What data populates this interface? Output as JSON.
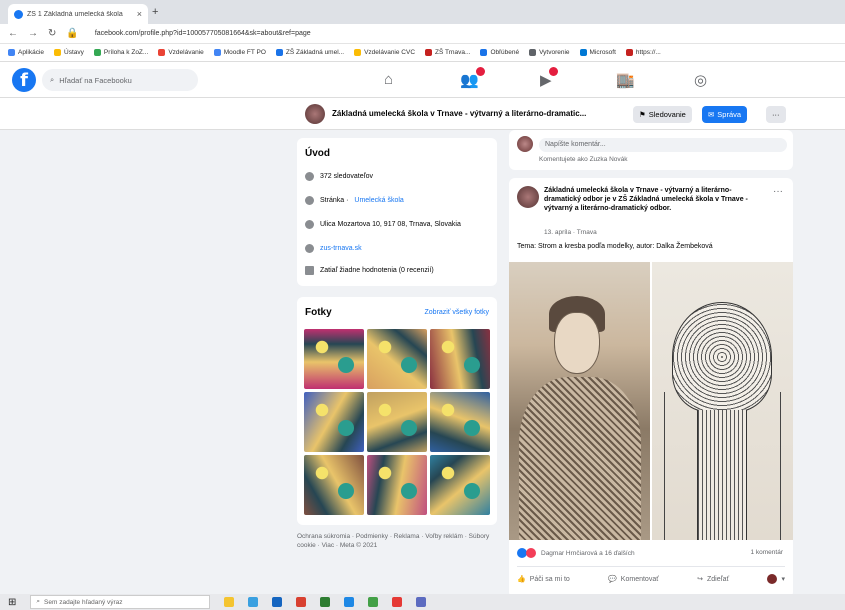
{
  "browser": {
    "tab_title": "ZŠ 1 Základná umelecká škola",
    "tab_close": "×",
    "new_tab": "+",
    "url": "facebook.com/profile.php?id=100057705081664&sk=about&ref=page",
    "bookmarks": [
      "Aplikácie",
      "Ústavy",
      "Príloha k ZoZ...",
      "Vzdelávanie",
      "Moodle FT PO",
      "ZŠ Základná umel...",
      "Vzdelávanie CVC",
      "ZŠ Trnava...",
      "Obľúbené",
      "Vytvorenie",
      "Microsoft",
      "https://..."
    ]
  },
  "fb": {
    "search_placeholder": "Hľadať na Facebooku"
  },
  "page": {
    "name": "Základná umelecká škola v Trnave - výtvarný a literárno-dramatic...",
    "btn_follow": "Sledovanie",
    "btn_message": "Správa",
    "btn_more": "···"
  },
  "intro": {
    "title": "Úvod",
    "rows": [
      {
        "text": "372 sledovateľov",
        "link": ""
      },
      {
        "text": "Stránka · ",
        "link": "Umelecká škola"
      },
      {
        "text": "Ulica Mozartova 10, 917 08, Trnava, Slovakia",
        "link": ""
      },
      {
        "text": "",
        "link": "zus-trnava.sk"
      },
      {
        "text": "Zatiaľ žiadne hodnotenia (0 recenzií)",
        "link": ""
      }
    ]
  },
  "photos": {
    "title": "Fotky",
    "see_all": "Zobraziť všetky fotky",
    "colors": [
      "#c03070",
      "#d8a060",
      "#8a3040",
      "#4060c0",
      "#c0a060",
      "#3060a0",
      "#805040",
      "#c05080",
      "#3080a0"
    ]
  },
  "footer": {
    "text": "Ochrana súkromia · Podmienky · Reklama · Voľby reklám · Súbory cookie · Viac · Meta © 2021"
  },
  "composer": {
    "placeholder": "Napíšte komentár...",
    "note": "Komentujete ako Zuzka Novák"
  },
  "post": {
    "title": "Základná umelecká škola v Trnave - výtvarný a literárno-dramatický odbor je v ZŠ Základná umelecká škola v Trnave - výtvarný a literárno-dramatický odbor.",
    "date": "13. apríla · Trnava",
    "more": "···",
    "text": "Tema: Strom a kresba podľa modelky, autor: Dalka Žembeková",
    "reactions": "Dagmar Hrnčiarová a 16 ďalších",
    "comments": "1 komentár",
    "like": "Páči sa mi to",
    "comment": "Komentovať",
    "share": "Zdieľať"
  },
  "taskbar": {
    "search_placeholder": "Sem zadajte hľadaný výraz",
    "apps": [
      "#f4c430",
      "#3aa0e0",
      "#1565c0",
      "#d84030",
      "#2e7d32",
      "#1e88e5",
      "#43a047",
      "#e53935",
      "#5c6bc0"
    ]
  }
}
